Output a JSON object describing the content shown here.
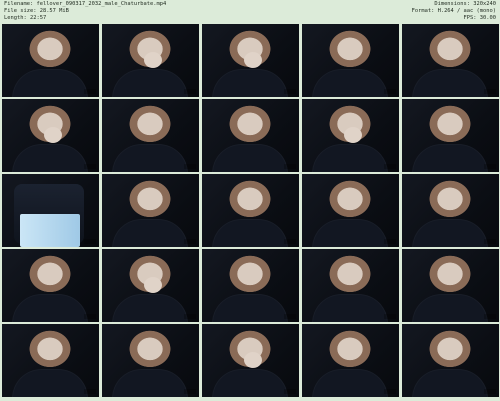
{
  "header": {
    "filename": "Filename: fellover_090317_2032_male_Chaturbate.mp4",
    "filesize": "File size: 28.57 MiB",
    "length": "Length: 22:57",
    "dimensions": "Dimensions: 320x240",
    "format": "Format: H.264 / aac (mono)",
    "fps": "FPS: 30.00"
  },
  "frames": [
    {
      "hand": false,
      "standing": false
    },
    {
      "hand": true,
      "standing": false
    },
    {
      "hand": true,
      "standing": false
    },
    {
      "hand": false,
      "standing": false
    },
    {
      "hand": false,
      "standing": false
    },
    {
      "hand": true,
      "standing": false
    },
    {
      "hand": false,
      "standing": false
    },
    {
      "hand": false,
      "standing": false
    },
    {
      "hand": true,
      "standing": false
    },
    {
      "hand": false,
      "standing": false
    },
    {
      "hand": false,
      "standing": true
    },
    {
      "hand": false,
      "standing": false
    },
    {
      "hand": false,
      "standing": false
    },
    {
      "hand": false,
      "standing": false
    },
    {
      "hand": false,
      "standing": false
    },
    {
      "hand": false,
      "standing": false
    },
    {
      "hand": true,
      "standing": false
    },
    {
      "hand": false,
      "standing": false
    },
    {
      "hand": false,
      "standing": false
    },
    {
      "hand": false,
      "standing": false
    },
    {
      "hand": false,
      "standing": false
    },
    {
      "hand": false,
      "standing": false
    },
    {
      "hand": true,
      "standing": false
    },
    {
      "hand": false,
      "standing": false
    },
    {
      "hand": false,
      "standing": false
    }
  ]
}
